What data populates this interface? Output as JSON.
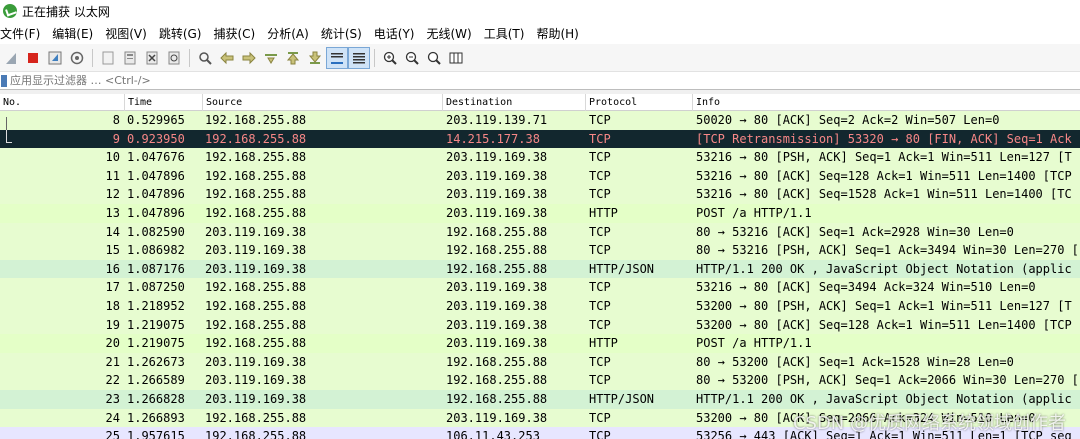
{
  "window": {
    "title": "正在捕获 以太网"
  },
  "menu": [
    "文件(F)",
    "编辑(E)",
    "视图(V)",
    "跳转(G)",
    "捕获(C)",
    "分析(A)",
    "统计(S)",
    "电话(Y)",
    "无线(W)",
    "工具(T)",
    "帮助(H)"
  ],
  "toolbar_icons": [
    "shark-fin-start-icon",
    "stop-capture-icon",
    "restart-capture-icon",
    "capture-options-icon",
    "open-file-icon",
    "save-file-icon",
    "close-file-icon",
    "reload-file-icon",
    "find-packet-icon",
    "go-back-icon",
    "go-forward-icon",
    "go-to-packet-icon",
    "go-first-icon",
    "go-last-icon",
    "autoscroll-icon",
    "colorize-icon",
    "zoom-in-icon",
    "zoom-out-icon",
    "zoom-normal-icon",
    "resize-columns-icon"
  ],
  "filter": {
    "placeholder": "应用显示过滤器 … <Ctrl-/>"
  },
  "columns": [
    "No.",
    "Time",
    "Source",
    "Destination",
    "Protocol",
    "Info"
  ],
  "colors": {
    "tcp_green": "#e7fcd0",
    "http_green": "#e4ffc7",
    "json_green": "#d3f2d4",
    "selected_bg": "#12272e",
    "selected_fg": "#f78787",
    "partial_row": "#e7e6ff"
  },
  "packets": [
    {
      "no": "8",
      "time": "0.529965",
      "src": "192.168.255.88",
      "dst": "203.119.139.71",
      "proto": "TCP",
      "info": "50020 → 80 [ACK] Seq=2 Ack=2 Win=507 Len=0",
      "style": "tcp"
    },
    {
      "no": "9",
      "time": "0.923950",
      "src": "192.168.255.88",
      "dst": "14.215.177.38",
      "proto": "TCP",
      "info": "[TCP Retransmission] 53320 → 80 [FIN, ACK] Seq=1 Ack",
      "style": "selected"
    },
    {
      "no": "10",
      "time": "1.047676",
      "src": "192.168.255.88",
      "dst": "203.119.169.38",
      "proto": "TCP",
      "info": "53216 → 80 [PSH, ACK] Seq=1 Ack=1 Win=511 Len=127 [T",
      "style": "tcp"
    },
    {
      "no": "11",
      "time": "1.047896",
      "src": "192.168.255.88",
      "dst": "203.119.169.38",
      "proto": "TCP",
      "info": "53216 → 80 [ACK] Seq=128 Ack=1 Win=511 Len=1400 [TCP",
      "style": "tcp"
    },
    {
      "no": "12",
      "time": "1.047896",
      "src": "192.168.255.88",
      "dst": "203.119.169.38",
      "proto": "TCP",
      "info": "53216 → 80 [ACK] Seq=1528 Ack=1 Win=511 Len=1400 [TC",
      "style": "tcp"
    },
    {
      "no": "13",
      "time": "1.047896",
      "src": "192.168.255.88",
      "dst": "203.119.169.38",
      "proto": "HTTP",
      "info": "POST /a HTTP/1.1",
      "style": "http"
    },
    {
      "no": "14",
      "time": "1.082590",
      "src": "203.119.169.38",
      "dst": "192.168.255.88",
      "proto": "TCP",
      "info": "80 → 53216 [ACK] Seq=1 Ack=2928 Win=30 Len=0",
      "style": "tcp"
    },
    {
      "no": "15",
      "time": "1.086982",
      "src": "203.119.169.38",
      "dst": "192.168.255.88",
      "proto": "TCP",
      "info": "80 → 53216 [PSH, ACK] Seq=1 Ack=3494 Win=30 Len=270 [",
      "style": "tcp"
    },
    {
      "no": "16",
      "time": "1.087176",
      "src": "203.119.169.38",
      "dst": "192.168.255.88",
      "proto": "HTTP/JSON",
      "info": "HTTP/1.1 200 OK , JavaScript Object Notation (applic",
      "style": "json"
    },
    {
      "no": "17",
      "time": "1.087250",
      "src": "192.168.255.88",
      "dst": "203.119.169.38",
      "proto": "TCP",
      "info": "53216 → 80 [ACK] Seq=3494 Ack=324 Win=510 Len=0",
      "style": "tcp"
    },
    {
      "no": "18",
      "time": "1.218952",
      "src": "192.168.255.88",
      "dst": "203.119.169.38",
      "proto": "TCP",
      "info": "53200 → 80 [PSH, ACK] Seq=1 Ack=1 Win=511 Len=127 [T",
      "style": "tcp"
    },
    {
      "no": "19",
      "time": "1.219075",
      "src": "192.168.255.88",
      "dst": "203.119.169.38",
      "proto": "TCP",
      "info": "53200 → 80 [ACK] Seq=128 Ack=1 Win=511 Len=1400 [TCP",
      "style": "tcp"
    },
    {
      "no": "20",
      "time": "1.219075",
      "src": "192.168.255.88",
      "dst": "203.119.169.38",
      "proto": "HTTP",
      "info": "POST /a HTTP/1.1",
      "style": "http"
    },
    {
      "no": "21",
      "time": "1.262673",
      "src": "203.119.169.38",
      "dst": "192.168.255.88",
      "proto": "TCP",
      "info": "80 → 53200 [ACK] Seq=1 Ack=1528 Win=28 Len=0",
      "style": "tcp"
    },
    {
      "no": "22",
      "time": "1.266589",
      "src": "203.119.169.38",
      "dst": "192.168.255.88",
      "proto": "TCP",
      "info": "80 → 53200 [PSH, ACK] Seq=1 Ack=2066 Win=30 Len=270 [",
      "style": "tcp"
    },
    {
      "no": "23",
      "time": "1.266828",
      "src": "203.119.169.38",
      "dst": "192.168.255.88",
      "proto": "HTTP/JSON",
      "info": "HTTP/1.1 200 OK , JavaScript Object Notation (applic",
      "style": "json"
    },
    {
      "no": "24",
      "time": "1.266893",
      "src": "192.168.255.88",
      "dst": "203.119.169.38",
      "proto": "TCP",
      "info": "53200 → 80 [ACK] Seq=2066 Ack=324 Win=510 Len=0",
      "style": "tcp"
    },
    {
      "no": "25",
      "time": "1.957615",
      "src": "192.168.255.88",
      "dst": "106.11.43.253",
      "proto": "TCP",
      "info": "53256 → 443 [ACK] Seq=1 Ack=1 Win=511 Len=1 [TCP seg",
      "style": "partial"
    }
  ],
  "watermark": "CSDN @优质网络系统领域创作者"
}
